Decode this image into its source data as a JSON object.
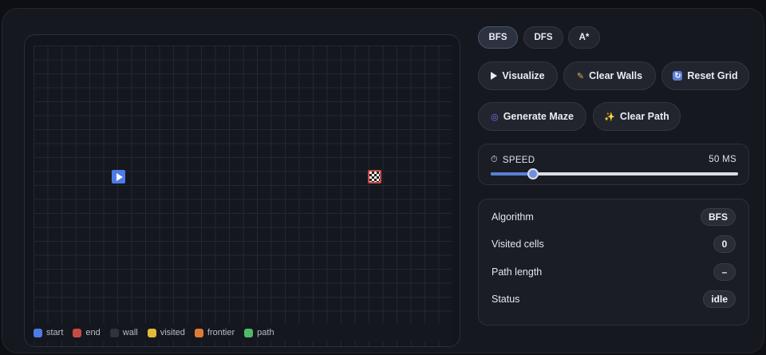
{
  "algorithms": [
    "BFS",
    "DFS",
    "A*"
  ],
  "selected_algorithm": "BFS",
  "actions": {
    "visualize": "Visualize",
    "clear_walls": "Clear Walls",
    "reset_grid": "Reset Grid",
    "generate_maze": "Generate Maze",
    "clear_path": "Clear Path"
  },
  "speed": {
    "label": "SPEED",
    "value_text": "50 MS",
    "fraction": 0.17
  },
  "stats": {
    "algorithm": {
      "label": "Algorithm",
      "value": "BFS"
    },
    "visited": {
      "label": "Visited cells",
      "value": "0"
    },
    "path_length": {
      "label": "Path length",
      "value": "–"
    },
    "status": {
      "label": "Status",
      "value": "idle"
    }
  },
  "legend": [
    {
      "label": "start",
      "color": "#4f7be8"
    },
    {
      "label": "end",
      "color": "#c94a45"
    },
    {
      "label": "wall",
      "color": "#2f333d"
    },
    {
      "label": "visited",
      "color": "#e2b93b"
    },
    {
      "label": "frontier",
      "color": "#e07b35"
    },
    {
      "label": "path",
      "color": "#4fb96a"
    }
  ],
  "icons": {
    "start_node": "play-icon",
    "end_node": "checkered-flag-icon",
    "clear_walls": "broom-icon",
    "reset_grid": "refresh-icon",
    "generate_maze": "maze-icon",
    "clear_path": "sparkles-icon",
    "speed": "stopwatch-icon"
  }
}
